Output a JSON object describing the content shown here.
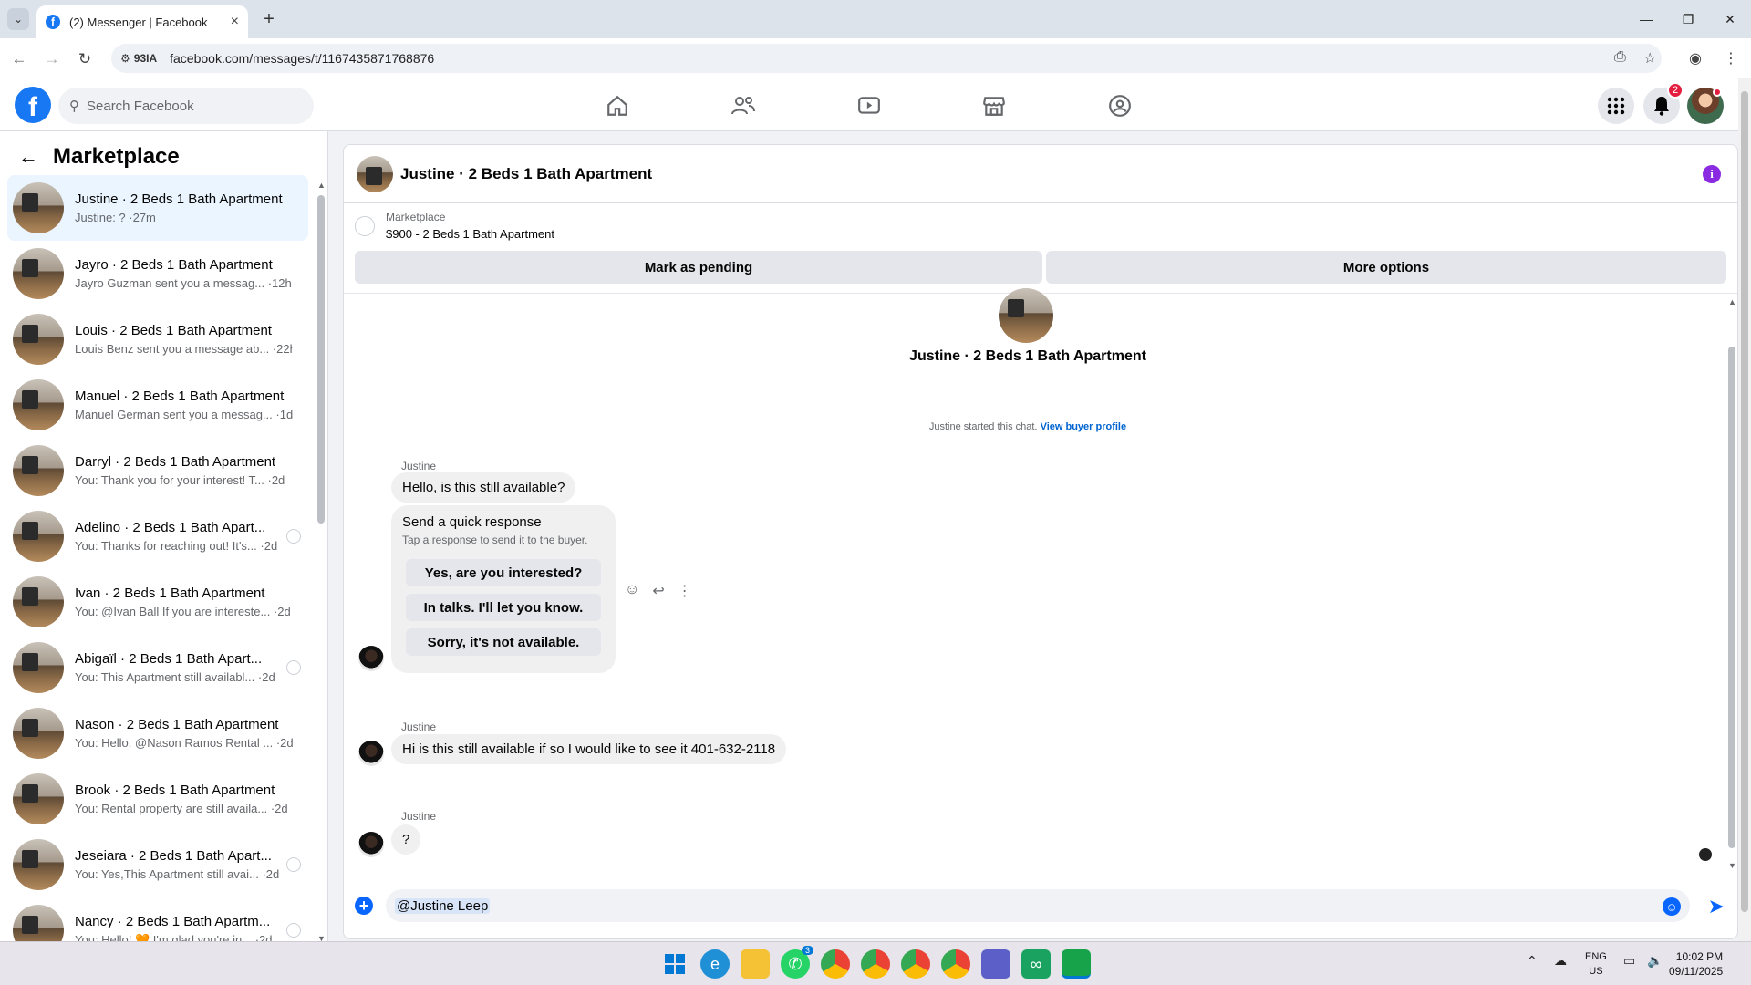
{
  "browser": {
    "tab_title": "(2) Messenger | Facebook",
    "site_chip": "93IA",
    "url": "facebook.com/messages/t/1167435871768876"
  },
  "fb": {
    "search_placeholder": "Search Facebook",
    "notification_count": "2"
  },
  "left_panel": {
    "title": "Marketplace",
    "conversations": [
      {
        "name": "Justine · 2 Beds 1 Bath Apartment",
        "preview": "Justine: ? ·27m"
      },
      {
        "name": "Jayro · 2 Beds 1 Bath Apartment",
        "preview": "Jayro Guzman sent you a messag... ·12h"
      },
      {
        "name": "Louis · 2 Beds 1 Bath Apartment",
        "preview": "Louis Benz sent you a message ab... ·22h"
      },
      {
        "name": "Manuel · 2 Beds 1 Bath Apartment",
        "preview": "Manuel German sent you a messag... ·1d"
      },
      {
        "name": "Darryl · 2 Beds 1 Bath Apartment",
        "preview": "You: Thank you for your interest! T... ·2d"
      },
      {
        "name": "Adelino · 2 Beds 1 Bath Apart...",
        "preview": "You: Thanks for reaching out! It's... ·2d"
      },
      {
        "name": "Ivan · 2 Beds 1 Bath Apartment",
        "preview": "You: @Ivan Ball If you are intereste... ·2d"
      },
      {
        "name": "Abigaïl · 2 Beds 1 Bath Apart...",
        "preview": "You: This Apartment still availabl... ·2d"
      },
      {
        "name": "Nason · 2 Beds 1 Bath Apartment",
        "preview": "You: Hello. @Nason Ramos Rental ... ·2d"
      },
      {
        "name": "Brook · 2 Beds 1 Bath Apartment",
        "preview": "You: Rental property are still availa... ·2d"
      },
      {
        "name": "Jeseiara · 2 Beds 1 Bath Apart...",
        "preview": "You: Yes,This Apartment still avai... ·2d"
      },
      {
        "name": "Nancy · 2 Beds 1 Bath Apartm...",
        "preview": "You: Hello! 🧡 I'm glad you're in... ·2d"
      }
    ]
  },
  "chat": {
    "title": "Justine · 2 Beds 1 Bath Apartment",
    "listing_label": "Marketplace",
    "listing_price": "$900 - 2 Beds 1 Bath Apartment",
    "mark_pending_label": "Mark as pending",
    "more_options_label": "More options",
    "hero_name": "Justine · 2 Beds 1 Bath Apartment",
    "started_text": "Justine started this chat.",
    "view_profile_label": "View buyer profile",
    "messages": [
      {
        "sender": "Justine",
        "text": "Hello, is this still available?"
      },
      {
        "sender": "Justine",
        "text": "Hi is this still available if so I would like to see it 401-632-2118"
      },
      {
        "sender": "Justine",
        "text": "?"
      }
    ],
    "quick_response": {
      "title": "Send a quick response",
      "subtitle": "Tap a response to send it to the buyer.",
      "options": [
        "Yes, are you interested?",
        "In talks. I'll let you know.",
        "Sorry, it's not available."
      ]
    },
    "composer_mention": "@Justine Leep"
  },
  "taskbar": {
    "lang_line1": "ENG",
    "lang_line2": "US",
    "time": "10:02 PM",
    "date": "09/11/2025",
    "whatsapp_badge": "3"
  }
}
